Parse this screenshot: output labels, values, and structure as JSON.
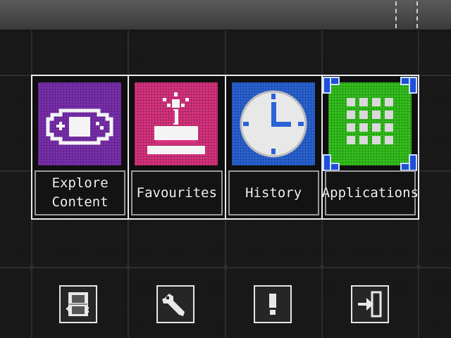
{
  "colors": {
    "explore": "#7a2fae",
    "favourites": "#d8327f",
    "history": "#2a63d6",
    "applications": "#33c21d",
    "selection": "#1e4fd8"
  },
  "tiles": [
    {
      "label": "Explore\nContent",
      "icon": "gamepad-icon",
      "selected": false
    },
    {
      "label": "Favourites",
      "icon": "cake-icon",
      "selected": false
    },
    {
      "label": "History",
      "icon": "clock-icon",
      "selected": false
    },
    {
      "label": "Applications",
      "icon": "app-grid-icon",
      "selected": true
    }
  ],
  "bottom_buttons": [
    {
      "icon": "handheld-console-icon"
    },
    {
      "icon": "wrench-icon"
    },
    {
      "icon": "info-exclamation-icon"
    },
    {
      "icon": "exit-door-icon"
    }
  ]
}
